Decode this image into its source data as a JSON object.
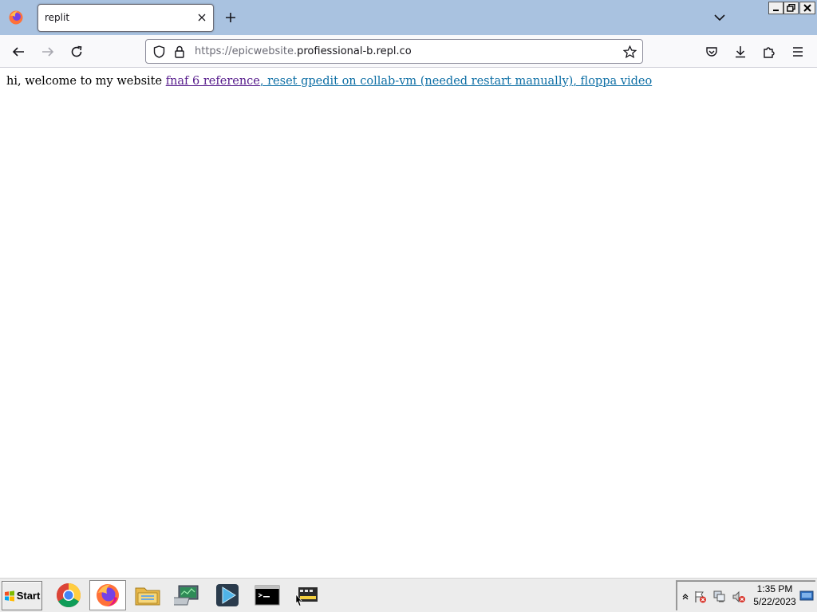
{
  "browser": {
    "tab": {
      "title": "replit"
    },
    "url": {
      "prefix": "https://epicwebsite.",
      "domain": "profiessional-b.repl.co"
    }
  },
  "page": {
    "intro": "hi, welcome to my website ",
    "links": [
      {
        "text": "fnaf 6 reference",
        "visited": true
      },
      {
        "text": ", reset gpedit on collab-vm (needed restart manually)",
        "visited": false
      },
      {
        "text": ", floppa video",
        "visited": false
      }
    ]
  },
  "taskbar": {
    "start_label": "Start",
    "apps": [
      {
        "name": "chrome-icon",
        "active": false
      },
      {
        "name": "firefox-icon",
        "active": true
      },
      {
        "name": "file-explorer-icon",
        "active": false
      },
      {
        "name": "computer-management-icon",
        "active": false
      },
      {
        "name": "media-player-icon",
        "active": false
      },
      {
        "name": "command-prompt-icon",
        "active": false
      },
      {
        "name": "video-editor-icon",
        "active": false
      }
    ],
    "clock": {
      "time": "1:35 PM",
      "date": "5/22/2023"
    }
  },
  "colors": {
    "titlebar": "#a9c2e0",
    "visited_link": "#551a8b",
    "link": "#0e6fa5"
  }
}
